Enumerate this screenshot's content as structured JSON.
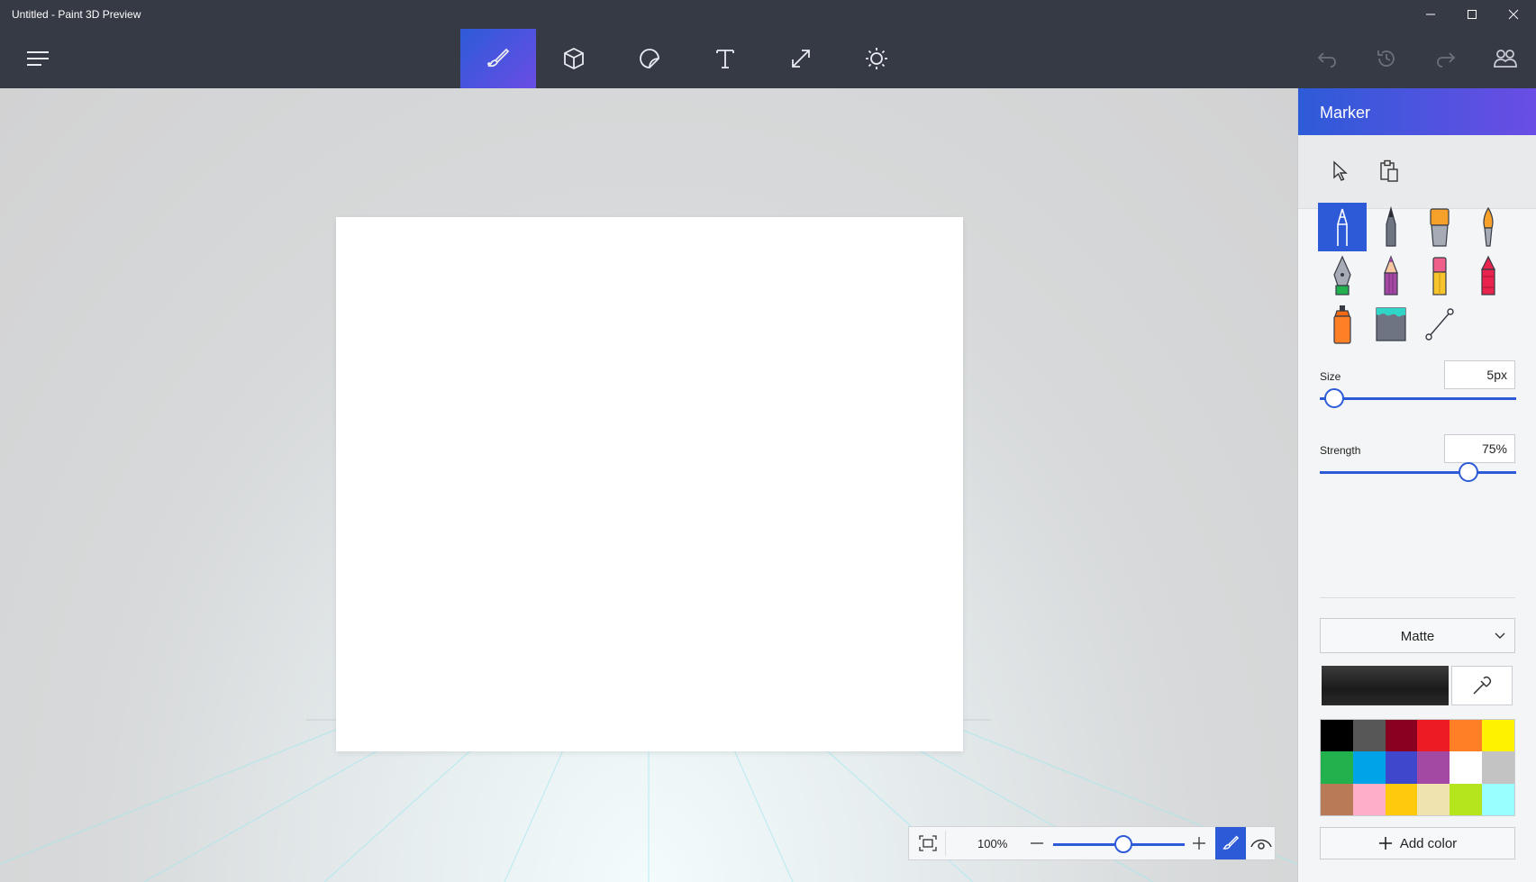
{
  "window": {
    "title": "Untitled - Paint 3D Preview",
    "controls": [
      "minimize-icon",
      "maximize-icon",
      "close-icon"
    ]
  },
  "toolbar": {
    "menu_icon": "hamburger-icon",
    "tabs": [
      {
        "name": "art-tools",
        "icon": "brush-icon",
        "active": true
      },
      {
        "name": "3d-objects",
        "icon": "cube-icon",
        "active": false
      },
      {
        "name": "stickers",
        "icon": "sticker-icon",
        "active": false
      },
      {
        "name": "text",
        "icon": "text-icon",
        "active": false
      },
      {
        "name": "canvas",
        "icon": "resize-icon",
        "active": false
      },
      {
        "name": "effects",
        "icon": "sun-icon",
        "active": false
      }
    ],
    "right_actions": [
      "undo-icon",
      "history-icon",
      "redo-icon",
      "community-icon"
    ]
  },
  "panel": {
    "title": "Marker",
    "actions": [
      "select-icon",
      "paste-icon"
    ],
    "brushes": [
      "marker",
      "calligraphy-pen",
      "oil-brush",
      "watercolor",
      "pixel-pen",
      "pencil",
      "eraser",
      "crayon",
      "spray-can",
      "fill",
      "line-tool"
    ],
    "size_label": "Size",
    "size_value": "5px",
    "size_level": 0.08,
    "strength_label": "Strength",
    "strength_value": "75%",
    "strength_level": 0.75,
    "finish": "Matte",
    "current_color": "#222222",
    "palette": [
      "#000000",
      "#575757",
      "#8a0020",
      "#ed1c24",
      "#ff7f27",
      "#fff200",
      "#22b14c",
      "#00a2e8",
      "#3f48cc",
      "#a349a4",
      "#ffffff",
      "#c3c3c3",
      "#b97a57",
      "#ffaec9",
      "#ffc90e",
      "#efe4b0",
      "#b5e61d",
      "#99ffff"
    ],
    "add_color_label": "Add color"
  },
  "zoom": {
    "value": "100%",
    "level": 0.5
  },
  "colors": {
    "accent": "#2d5bd8",
    "accent2": "#6a4de4",
    "chrome": "#353a45"
  }
}
